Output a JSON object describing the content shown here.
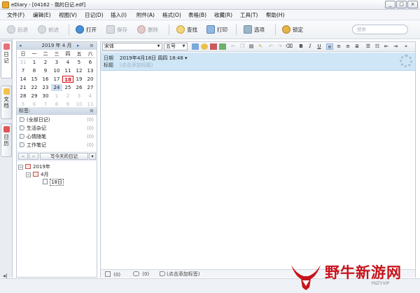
{
  "window": {
    "title": "eDiary - [04162 - 我的日记.edf]",
    "controls": [
      "_",
      "□",
      "×"
    ]
  },
  "menu": [
    "文件(F)",
    "编辑(E)",
    "视图(V)",
    "日记(D)",
    "插入(I)",
    "附件(A)",
    "格式(O)",
    "表格(B)",
    "收藏(R)",
    "工具(T)",
    "帮助(H)"
  ],
  "toolbar": {
    "back": "后退",
    "forward": "前进",
    "open": "打开",
    "save": "保存",
    "delete": "删除",
    "find": "查找",
    "print": "打印",
    "options": "选项",
    "lock": "锁定",
    "search_placeholder": "搜索"
  },
  "side_tabs": [
    "日记",
    "文档",
    "日历"
  ],
  "calendar": {
    "header": "2019 年 4 月",
    "weekdays": [
      "日",
      "一",
      "二",
      "三",
      "四",
      "五",
      "六"
    ],
    "days": [
      [
        "31",
        "1",
        "2",
        "3",
        "4",
        "5",
        "6"
      ],
      [
        "7",
        "8",
        "9",
        "10",
        "11",
        "12",
        "13"
      ],
      [
        "14",
        "15",
        "16",
        "17",
        "18",
        "19",
        "20"
      ],
      [
        "21",
        "22",
        "23",
        "24",
        "25",
        "26",
        "27"
      ],
      [
        "28",
        "29",
        "30",
        "1",
        "2",
        "3",
        "4"
      ],
      [
        "5",
        "6",
        "7",
        "8",
        "9",
        "10",
        "11"
      ]
    ],
    "today": "18"
  },
  "tags": {
    "header": "标签:",
    "items": [
      {
        "label": "(全部日记)",
        "count": "(0)"
      },
      {
        "label": "生活杂记",
        "count": "(0)"
      },
      {
        "label": "心情随笔",
        "count": "(0)"
      },
      {
        "label": "工作笔记",
        "count": "(0)"
      }
    ]
  },
  "nav": {
    "prev": "<",
    "next": ">",
    "today": "写今天的日记",
    "menu": "▾"
  },
  "tree": {
    "year": "2019年",
    "month": "4月",
    "day": "18日"
  },
  "editor": {
    "font": "宋体",
    "size": "五号",
    "date_label": "日期",
    "date_value": "2019年4月18日 周四 18:48 ▾",
    "title_label": "标题",
    "title_placeholder": "(点击添加标题)",
    "attach_count": "(0)",
    "comment_count": "(0)",
    "tag_placeholder": "(点击添加标签)"
  },
  "watermark": {
    "text": "野牛新游网",
    "url": "YNZY.VIP"
  },
  "colors": {
    "accent": "#cfe6f6",
    "today": "#d4141c",
    "watermark": "#c7141c"
  }
}
